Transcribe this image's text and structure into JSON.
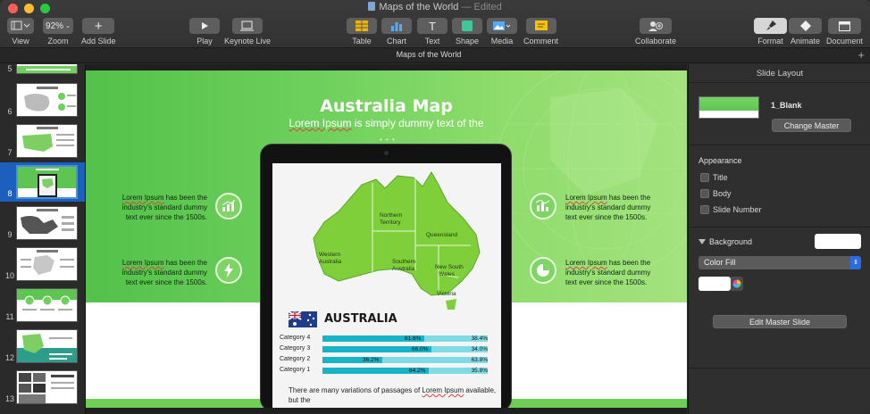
{
  "window": {
    "title": "Maps of the World",
    "edited_suffix": "— Edited"
  },
  "toolbar": {
    "view": "View",
    "zoom": "Zoom",
    "zoom_value": "92%",
    "add_slide": "Add Slide",
    "play": "Play",
    "keynote_live": "Keynote Live",
    "table": "Table",
    "chart": "Chart",
    "text": "Text",
    "shape": "Shape",
    "media": "Media",
    "comment": "Comment",
    "collaborate": "Collaborate",
    "format": "Format",
    "animate": "Animate",
    "document": "Document"
  },
  "tabbar": {
    "title": "Maps of the World"
  },
  "navigator": {
    "slides": [
      {
        "number": "5"
      },
      {
        "number": "6"
      },
      {
        "number": "7"
      },
      {
        "number": "8",
        "selected": true
      },
      {
        "number": "9"
      },
      {
        "number": "10"
      },
      {
        "number": "11"
      },
      {
        "number": "12"
      },
      {
        "number": "13"
      }
    ]
  },
  "slide": {
    "title": "Australia Map",
    "subtitle_ul": "Lorem Ipsum",
    "subtitle_rest": " is simply dummy text of the",
    "features": [
      {
        "ul": "Lorem Ipsum",
        "text": " has been the industry's standard dummy text ever since the 1500s."
      },
      {
        "ul": "Lorem Ipsum",
        "text": " has been the industry's standard dummy text ever since the 1500s."
      },
      {
        "ul": "Lorem Ipsum",
        "text": " has been the industry's standard dummy text ever since the 1500s."
      },
      {
        "ul": "Lorem Ipsum",
        "text": " has been the industry's standard dummy text ever since the 1500s."
      }
    ],
    "map_regions": {
      "western_australia_1": "Western",
      "western_australia_2": "Australia",
      "northern_territory_1": "Northern",
      "northern_territory_2": "Territory",
      "queensland": "Queensland",
      "south_australia_1": "Southern",
      "south_australia_2": "Australia",
      "nsw_1": "New South",
      "nsw_2": "Wales",
      "victoria": "Victoria"
    },
    "country_label": "AUSTRALIA",
    "categories": [
      {
        "name": "Category 4",
        "v1": "61.6%",
        "v2": "38.4%",
        "fill": 0.616
      },
      {
        "name": "Category 3",
        "v1": "66.0%",
        "v2": "34.0%",
        "fill": 0.66
      },
      {
        "name": "Category 2",
        "v1": "36.2%",
        "v2": "63.8%",
        "fill": 0.362
      },
      {
        "name": "Category 1",
        "v1": "64.2%",
        "v2": "35.8%",
        "fill": 0.642
      }
    ],
    "paragraph_pre": "There are many variations of passages of ",
    "paragraph_ul": "Lorem Ipsum",
    "paragraph_post": " available, but the"
  },
  "inspector": {
    "header": "Slide Layout",
    "master_name": "1_Blank",
    "change_master": "Change Master",
    "appearance": "Appearance",
    "title_opt": "Title",
    "body_opt": "Body",
    "slide_number_opt": "Slide Number",
    "background": "Background",
    "fill_type": "Color Fill",
    "edit_master": "Edit Master Slide"
  },
  "colors": {
    "accent_green": "#5ec553",
    "bar_fill": "#17b4c8",
    "bar_track": "#7fdbe4",
    "selection_blue": "#1d5fbd"
  }
}
